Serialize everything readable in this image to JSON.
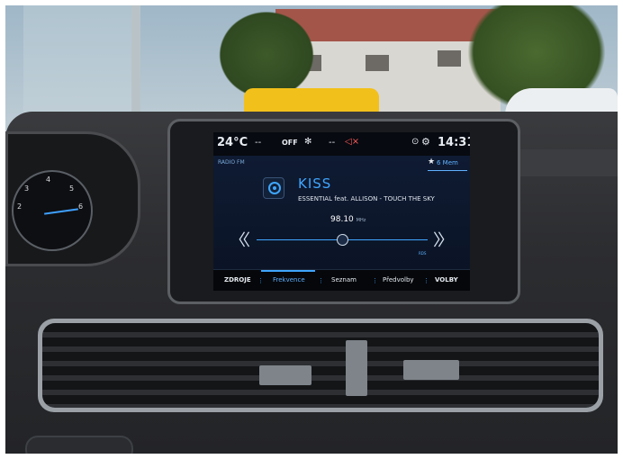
{
  "status_bar": {
    "temperature": "24°C",
    "left_dash": "--",
    "fan_status": "OFF",
    "fan_icon": "fan-icon",
    "right_dash": "--",
    "mute_icon": "speaker-mute-icon",
    "location_icon": "location-pin-icon",
    "settings_icon": "gear-icon",
    "time": "14:31"
  },
  "radio": {
    "source_label": "RADIO FM",
    "memory_label": "6 Mem",
    "station_name": "KISS",
    "now_playing": "ESSENTIAL feat. ALLISON - TOUCH THE SKY",
    "frequency": "98.10",
    "frequency_unit": "MHz",
    "band_label": "RDS",
    "tune_position": 0.5
  },
  "menu": {
    "items": [
      {
        "label": "ZDROJE"
      },
      {
        "label": "Frekvence"
      },
      {
        "label": "Seznam"
      },
      {
        "label": "Předvolby"
      },
      {
        "label": "VOLBY"
      }
    ],
    "active_index": 1
  },
  "colors": {
    "accent": "#3fa6ff",
    "screen_background": "#0b1220",
    "mute": "#ff5a5a"
  }
}
